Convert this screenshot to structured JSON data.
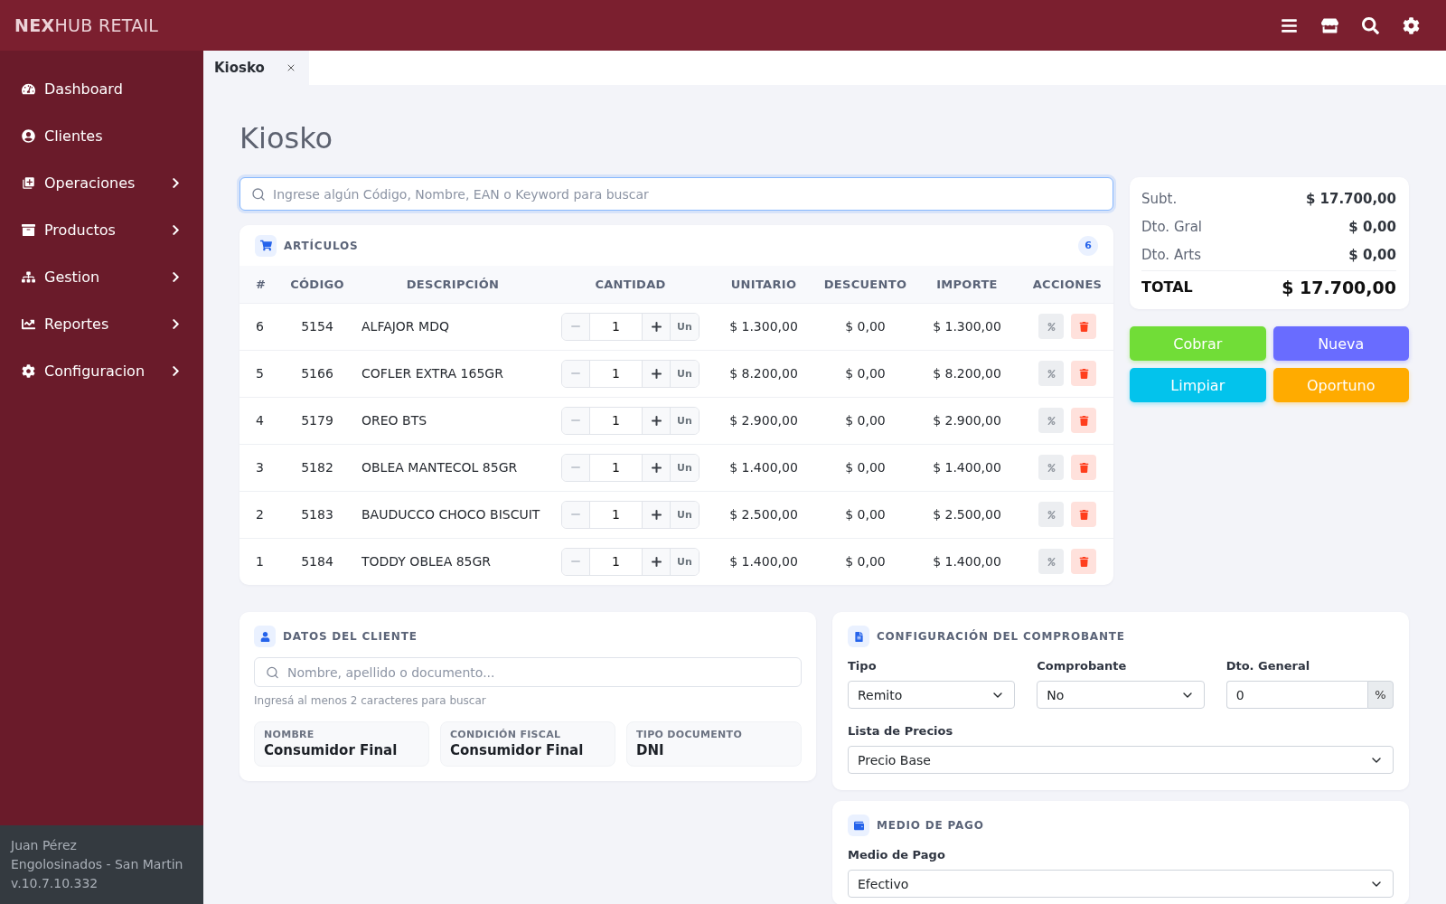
{
  "topbar": {
    "logo": "**NEX**HUB RETAIL"
  },
  "sidebar": {
    "items": [
      {
        "label": "Dashboard",
        "kind": "link"
      },
      {
        "label": "Clientes",
        "kind": "link"
      },
      {
        "label": "Operaciones",
        "kind": "submenu"
      },
      {
        "label": "Productos",
        "kind": "submenu"
      },
      {
        "label": "Gestion",
        "kind": "submenu"
      },
      {
        "label": "Reportes",
        "kind": "submenu"
      },
      {
        "label": "Configuracion",
        "kind": "submenu"
      }
    ],
    "footer": [
      "Juan Pérez",
      "Engolosinados - San Martin",
      "v.10.7.10.332"
    ]
  },
  "tabs": [
    {
      "label": "Kiosko",
      "selected": true
    }
  ],
  "page_title": "Kiosko",
  "search": {
    "placeholder": "Ingrese algún Código, Nombre, EAN o Keyword para buscar"
  },
  "articles": {
    "title": "ARTÍCULOS",
    "count": "6",
    "columns": [
      "#",
      "CÓDIGO",
      "DESCRIPCIÓN",
      "CANTIDAD",
      "UNITARIO",
      "DESCUENTO",
      "IMPORTE",
      "ACCIONES"
    ],
    "rows": [
      {
        "number": "6",
        "code": "5154",
        "description": "ALFAJOR MDQ",
        "quantity": "1",
        "decrease_disabled": true,
        "unit": "Un",
        "unit_price": "$ 1.300,00",
        "discount": "$ 0,00",
        "amount": "$ 1.300,00"
      },
      {
        "number": "5",
        "code": "5166",
        "description": "COFLER EXTRA 165GR",
        "quantity": "1",
        "decrease_disabled": true,
        "unit": "Un",
        "unit_price": "$ 8.200,00",
        "discount": "$ 0,00",
        "amount": "$ 8.200,00"
      },
      {
        "number": "4",
        "code": "5179",
        "description": "OREO BTS",
        "quantity": "1",
        "decrease_disabled": true,
        "unit": "Un",
        "unit_price": "$ 2.900,00",
        "discount": "$ 0,00",
        "amount": "$ 2.900,00"
      },
      {
        "number": "3",
        "code": "5182",
        "description": "OBLEA MANTECOL 85GR",
        "quantity": "1",
        "decrease_disabled": true,
        "unit": "Un",
        "unit_price": "$ 1.400,00",
        "discount": "$ 0,00",
        "amount": "$ 1.400,00"
      },
      {
        "number": "2",
        "code": "5183",
        "description": "BAUDUCCO CHOCO BISCUIT",
        "quantity": "1",
        "decrease_disabled": true,
        "unit": "Un",
        "unit_price": "$ 2.500,00",
        "discount": "$ 0,00",
        "amount": "$ 2.500,00"
      },
      {
        "number": "1",
        "code": "5184",
        "description": "TODDY OBLEA 85GR",
        "quantity": "1",
        "decrease_disabled": true,
        "unit": "Un",
        "unit_price": "$ 1.400,00",
        "discount": "$ 0,00",
        "amount": "$ 1.400,00"
      }
    ]
  },
  "summary": [
    {
      "label": "Subt.",
      "value": "$ 17.700,00",
      "kind": "line"
    },
    {
      "label": "Dto. Gral",
      "value": "$ 0,00",
      "kind": "line"
    },
    {
      "label": "Dto. Arts",
      "value": "$ 0,00",
      "kind": "line"
    },
    {
      "label": "TOTAL",
      "value": "$ 17.700,00",
      "kind": "total"
    }
  ],
  "actions": [
    {
      "label": "Cobrar",
      "color": "#71dd37"
    },
    {
      "label": "Nueva",
      "color": "#696cff"
    },
    {
      "label": "Limpiar",
      "color": "#03c3ec"
    },
    {
      "label": "Oportuno",
      "color": "#ffab00"
    }
  ],
  "client": {
    "title": "DATOS DEL CLIENTE",
    "search": {
      "placeholder": "Nombre, apellido o documento..."
    },
    "hint": "Ingresá al menos 2 caracteres para buscar",
    "fields": [
      {
        "label": "NOMBRE",
        "value": "Consumidor Final"
      },
      {
        "label": "CONDICIÓN FISCAL",
        "value": "Consumidor Final"
      },
      {
        "label": "TIPO DOCUMENTO",
        "value": "DNI"
      }
    ]
  },
  "voucher": {
    "title": "CONFIGURACIÓN DEL COMPROBANTE",
    "rows": [
      [
        {
          "label": "Tipo",
          "kind": "select",
          "value": "Remito"
        },
        {
          "label": "Comprobante",
          "kind": "select",
          "value": "No"
        },
        {
          "label": "Dto. General",
          "kind": "addon",
          "value": "0",
          "addon": "%"
        }
      ],
      [
        {
          "label": "Lista de Precios",
          "kind": "select",
          "value": "Precio Base"
        }
      ]
    ]
  },
  "payment": {
    "title": "MEDIO DE PAGO",
    "rows": [
      [
        {
          "label": "Medio de Pago",
          "kind": "select",
          "value": "Efectivo"
        }
      ]
    ]
  }
}
